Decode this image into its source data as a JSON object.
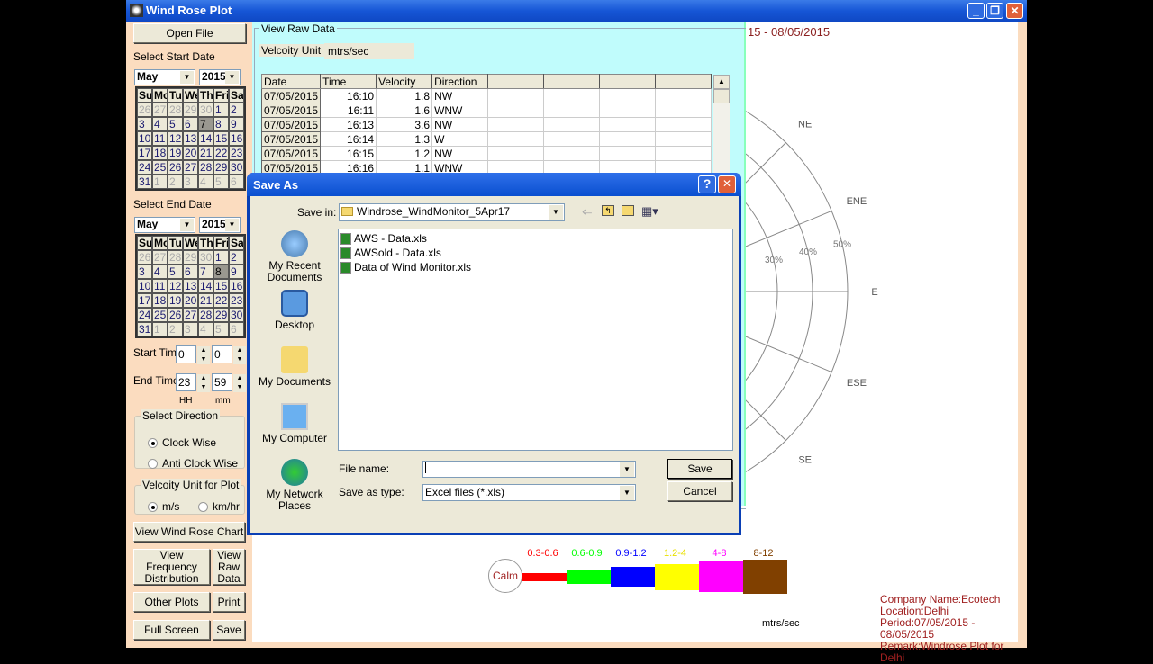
{
  "window": {
    "title": "Wind Rose Plot",
    "controls": [
      "minimize",
      "restore",
      "close"
    ]
  },
  "left": {
    "open_file": "Open File",
    "start_label": "Select Start Date",
    "end_label": "Select End Date",
    "start": {
      "month": "May",
      "year": "2015",
      "selected": "7"
    },
    "end": {
      "month": "May",
      "year": "2015",
      "selected": "8"
    },
    "weekdays": [
      "Sun",
      "Mon",
      "Tue",
      "Wed",
      "Thu",
      "Fri",
      "Sat"
    ],
    "days": [
      "26",
      "27",
      "28",
      "29",
      "30",
      "1",
      "2",
      "3",
      "4",
      "5",
      "6",
      "7",
      "8",
      "9",
      "10",
      "11",
      "12",
      "13",
      "14",
      "15",
      "16",
      "17",
      "18",
      "19",
      "20",
      "21",
      "22",
      "23",
      "24",
      "25",
      "26",
      "27",
      "28",
      "29",
      "30",
      "31",
      "1",
      "2",
      "3",
      "4",
      "5",
      "6"
    ],
    "start_time_label": "Start Time",
    "end_time_label": "End Time",
    "start_hh": "0",
    "start_mm": "0",
    "end_hh": "23",
    "end_mm": "59",
    "hh": "HH",
    "mm": "mm",
    "direction_legend": "Select Direction",
    "clockwise": "Clock Wise",
    "anticlockwise": "Anti Clock Wise",
    "direction_selected": "Clock Wise",
    "unit_legend": "Velcoity Unit for Plot",
    "unit_ms": "m/s",
    "unit_kmh": "km/hr",
    "unit_selected": "m/s",
    "view_chart": "View Wind Rose Chart",
    "view_freq": "View Frequency Distribution",
    "view_raw": "View Raw Data",
    "other_plots": "Other Plots",
    "print": "Print",
    "full_screen": "Full Screen",
    "save": "Save"
  },
  "raw": {
    "legend": "View Raw Data",
    "unit_label": "Velcoity Unit :",
    "unit_value": "mtrs/sec",
    "columns": [
      "Date",
      "Time",
      "Velocity",
      "Direction",
      "",
      "",
      "",
      ""
    ],
    "rows": [
      [
        "07/05/2015",
        "16:10",
        "1.8",
        "NW"
      ],
      [
        "07/05/2015",
        "16:11",
        "1.6",
        "WNW"
      ],
      [
        "07/05/2015",
        "16:13",
        "3.6",
        "NW"
      ],
      [
        "07/05/2015",
        "16:14",
        "1.3",
        "W"
      ],
      [
        "07/05/2015",
        "16:15",
        "1.2",
        "NW"
      ],
      [
        "07/05/2015",
        "16:16",
        "1.1",
        "WNW"
      ]
    ]
  },
  "chart": {
    "period_partial": "15 - 08/05/2015",
    "directions": [
      "NE",
      "ENE",
      "E",
      "ESE",
      "SE"
    ],
    "ring_labels": [
      "30%",
      "40%",
      "50%"
    ],
    "legend": {
      "calm": "Calm",
      "unit": "mtrs/sec",
      "bins": [
        {
          "label": "0.3-0.6",
          "color": "#ff0000"
        },
        {
          "label": "0.6-0.9",
          "color": "#00ff00"
        },
        {
          "label": "0.9-1.2",
          "color": "#0000ff"
        },
        {
          "label": "1.2-4",
          "color": "#ffff00"
        },
        {
          "label": "4-8",
          "color": "#ff00ff"
        },
        {
          "label": "8-12",
          "color": "#804000"
        }
      ]
    },
    "info": [
      "Company Name:Ecotech",
      "Location:Delhi",
      "Period:07/05/2015 - 08/05/2015",
      "Remark:Windrose Plot for Delhi"
    ]
  },
  "dialog": {
    "title": "Save As",
    "save_in_label": "Save in:",
    "save_in": "Windrose_WindMonitor_5Apr17",
    "places": [
      "My Recent Documents",
      "Desktop",
      "My Documents",
      "My Computer",
      "My Network Places"
    ],
    "files": [
      "AWS - Data.xls",
      "AWSold - Data.xls",
      "Data of Wind Monitor.xls"
    ],
    "file_name_label": "File name:",
    "file_name": "",
    "save_type_label": "Save as type:",
    "save_type": "Excel files (*.xls)",
    "save": "Save",
    "cancel": "Cancel",
    "help": "?"
  }
}
